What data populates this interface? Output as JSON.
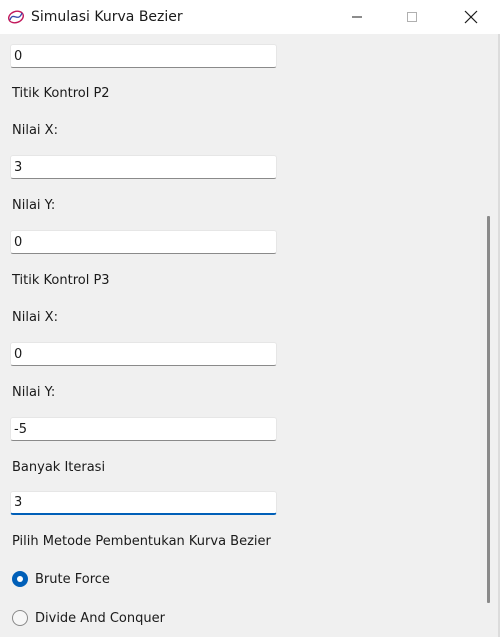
{
  "window": {
    "title": "Simulasi Kurva Bezier"
  },
  "form": {
    "p1_y_value": "0",
    "p2_heading": "Titik Kontrol P2",
    "p2_x_label": "Nilai X:",
    "p2_x_value": "3",
    "p2_y_label": "Nilai Y:",
    "p2_y_value": "0",
    "p3_heading": "Titik Kontrol P3",
    "p3_x_label": "Nilai X:",
    "p3_x_value": "0",
    "p3_y_label": "Nilai Y:",
    "p3_y_value": "-5",
    "iterations_label": "Banyak Iterasi",
    "iterations_value": "3",
    "method_label": "Pilih Metode Pembentukan Kurva Bezier",
    "methods": [
      {
        "label": "Brute Force",
        "selected": true
      },
      {
        "label": "Divide And Conquer",
        "selected": false
      }
    ]
  },
  "colors": {
    "accent": "#005fb8",
    "background": "#f0f0f0"
  }
}
